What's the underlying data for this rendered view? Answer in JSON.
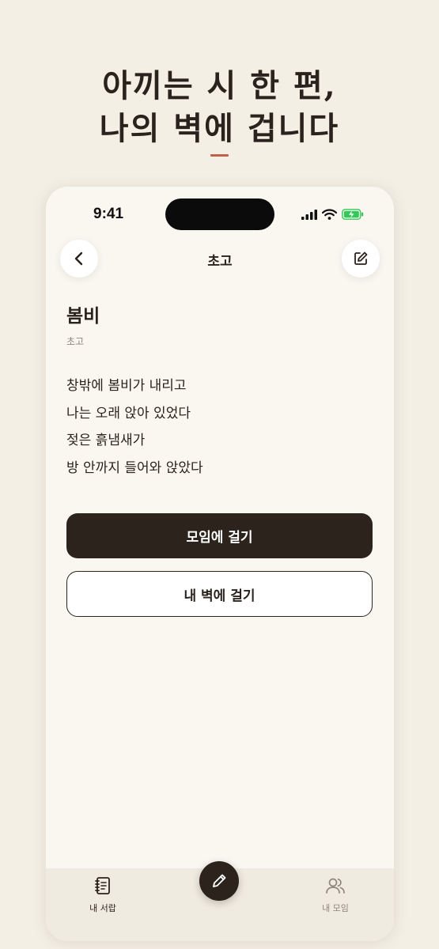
{
  "headline": {
    "line1": "아끼는 시 한 편,",
    "line2": "나의 벽에 겁니다"
  },
  "colors": {
    "accent": "#c0624a",
    "primary": "#2b231c",
    "background": "#f3efe5",
    "card": "#faf7f1",
    "battery": "#34c759"
  },
  "status_bar": {
    "time": "9:41"
  },
  "nav": {
    "title": "초고",
    "back_icon": "chevron-left-icon",
    "edit_icon": "edit-icon"
  },
  "poem": {
    "title": "봄비",
    "status": "초고",
    "lines": [
      "창밖에 봄비가 내리고",
      "나는 오래 앉아 있었다",
      "젖은 흙냄새가",
      "방 안까지 들어와 앉았다"
    ]
  },
  "actions": {
    "primary_label": "모임에 걸기",
    "secondary_label": "내 벽에 걸기"
  },
  "tabbar": {
    "left": {
      "label": "내 서랍",
      "icon": "notebook-icon"
    },
    "center": {
      "icon": "pencil-icon"
    },
    "right": {
      "label": "내 모임",
      "icon": "users-icon"
    }
  }
}
